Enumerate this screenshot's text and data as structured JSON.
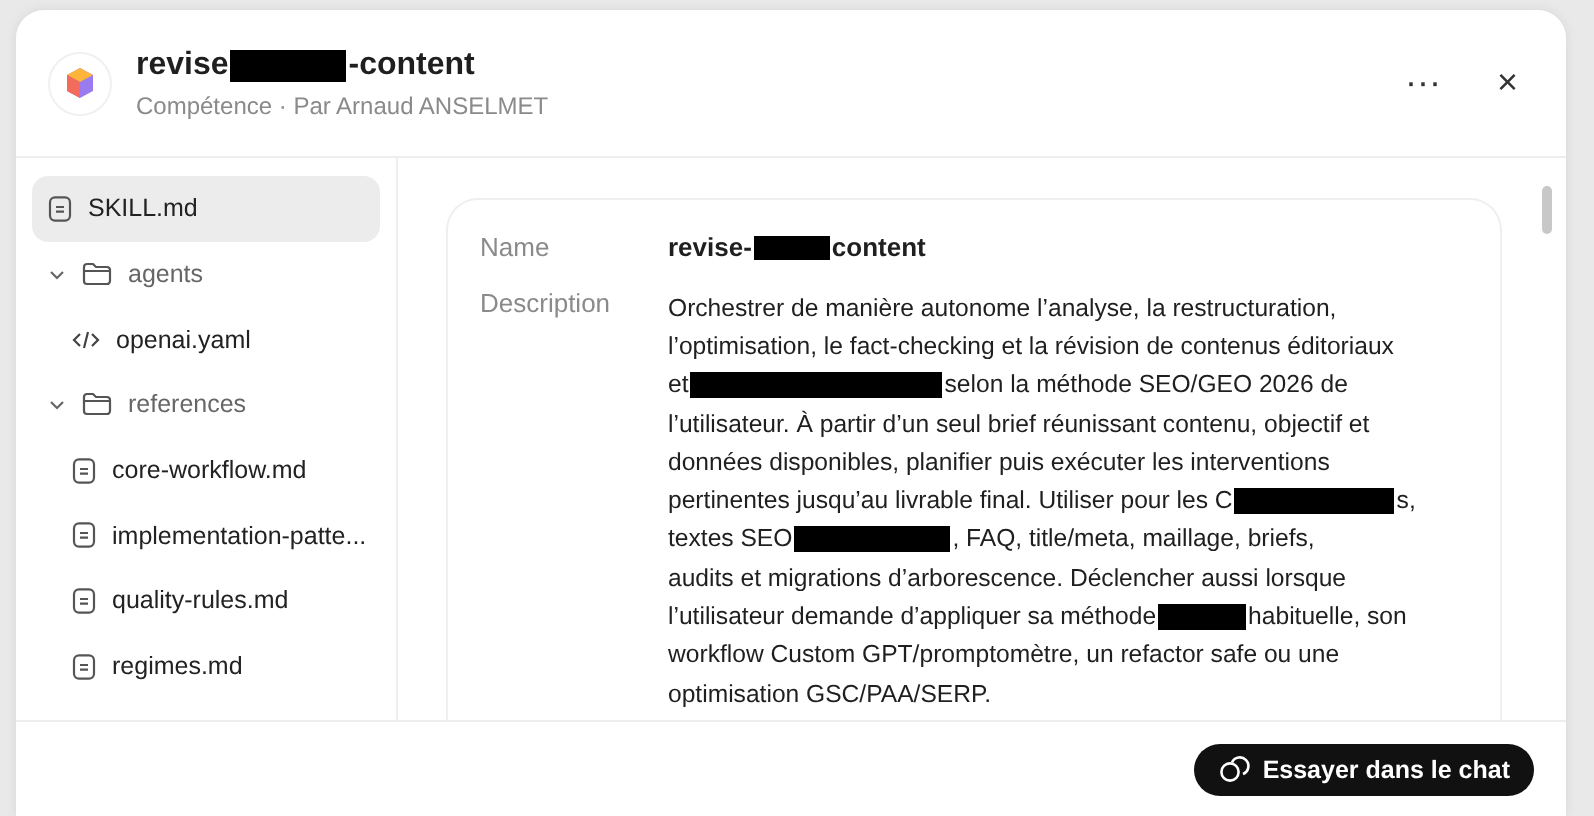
{
  "header": {
    "title": [
      {
        "kind": "text",
        "text": "revise"
      },
      {
        "kind": "redacted"
      },
      {
        "kind": "text",
        "text": "-content"
      }
    ],
    "subtitle": "Compétence · Par Arnaud ANSELMET",
    "menu": "···",
    "close": "×"
  },
  "files": [
    {
      "kind": "file",
      "name": "SKILL.md",
      "selected": true
    },
    {
      "kind": "folder",
      "name": "agents",
      "expanded": true,
      "children": [
        {
          "kind": "code",
          "name": "openai.yaml",
          "selected": false
        }
      ]
    },
    {
      "kind": "folder",
      "name": "references",
      "expanded": true,
      "children": [
        {
          "kind": "file",
          "name": "core-workflow.md",
          "selected": false
        },
        {
          "kind": "file",
          "name": "implementation-patte...",
          "selected": false
        },
        {
          "kind": "file",
          "name": "quality-rules.md",
          "selected": false
        },
        {
          "kind": "file",
          "name": "regimes.md",
          "selected": false
        }
      ]
    }
  ],
  "details": {
    "name_label": "Name",
    "name": [
      {
        "kind": "text",
        "text": "revise-"
      },
      {
        "kind": "redacted"
      },
      {
        "kind": "text",
        "text": "content"
      }
    ],
    "description_label": "Description",
    "description": [
      [
        {
          "kind": "text",
          "text": "Orchestrer de manière autonome l’analyse, la restructuration,"
        }
      ],
      [
        {
          "kind": "text",
          "text": "l’optimisation, le fact-checking et la révision de contenus éditoriaux"
        }
      ],
      [
        {
          "kind": "text",
          "text": "et"
        },
        {
          "kind": "redacted"
        },
        {
          "kind": "text",
          "text": "selon la méthode SEO/GEO 2026 de"
        }
      ],
      [
        {
          "kind": "text",
          "text": "l’utilisateur. À partir d’un seul brief réunissant contenu, objectif et"
        }
      ],
      [
        {
          "kind": "text",
          "text": "données disponibles, planifier puis exécuter les interventions"
        }
      ],
      [
        {
          "kind": "text",
          "text": "pertinentes jusqu’au livrable final. Utiliser pour les C"
        },
        {
          "kind": "redacted"
        },
        {
          "kind": "text",
          "text": "s,"
        }
      ],
      [
        {
          "kind": "text",
          "text": "textes SEO"
        },
        {
          "kind": "redacted"
        },
        {
          "kind": "text",
          "text": ", FAQ, title/meta, maillage, briefs,"
        }
      ],
      [
        {
          "kind": "text",
          "text": "audits et migrations d’arborescence. Déclencher aussi lorsque"
        }
      ],
      [
        {
          "kind": "text",
          "text": "l’utilisateur demande d’appliquer sa méthode"
        },
        {
          "kind": "redacted"
        },
        {
          "kind": "text",
          "text": "habituelle, son"
        }
      ],
      [
        {
          "kind": "text",
          "text": "workflow Custom GPT/promptomètre, un refactor safe ou une"
        }
      ],
      [
        {
          "kind": "text",
          "text": "optimisation GSC/PAA/SERP."
        }
      ]
    ]
  },
  "footer": {
    "button": "Essayer dans le chat"
  }
}
